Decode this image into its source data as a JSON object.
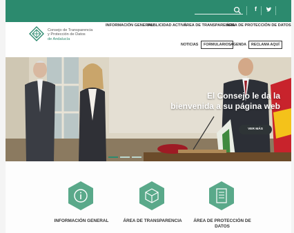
{
  "topbar": {
    "social": [
      {
        "icon": "facebook-icon",
        "glyph": "f"
      },
      {
        "icon": "twitter-icon",
        "glyph": "🐦"
      }
    ]
  },
  "logo": {
    "line1": "Consejo de Transparencia",
    "line2": "y Protección de Datos",
    "line3": "de Andalucía"
  },
  "nav": {
    "main": [
      "INFORMACIÓN GENERAL",
      "PUBLICIDAD ACTIVA",
      "ÁREA DE TRANSPARENCIA",
      "ÁREA DE PROTECCIÓN DE DATOS"
    ],
    "sub": [
      "NOTICIAS",
      "FORMULARIOS",
      "AGENDA",
      "RECLAMA AQUÍ"
    ]
  },
  "hero": {
    "title_line1": "El Consejo le da la",
    "title_line2": "bienvenida a su página web",
    "button": "VER MÁS",
    "slides": 3,
    "active_slide": 0
  },
  "cards": [
    {
      "label_line1": "INFORMACIÓN GENERAL",
      "label_line2": "",
      "icon": "info-icon"
    },
    {
      "label_line1": "ÁREA DE TRANSPARENCIA",
      "label_line2": "",
      "icon": "cube-icon"
    },
    {
      "label_line1": "ÁREA DE PROTECCIÓN DE",
      "label_line2": "DATOS",
      "icon": "document-icon"
    }
  ],
  "colors": {
    "brand": "#2c8a6e",
    "button_dark": "#2e3436"
  }
}
